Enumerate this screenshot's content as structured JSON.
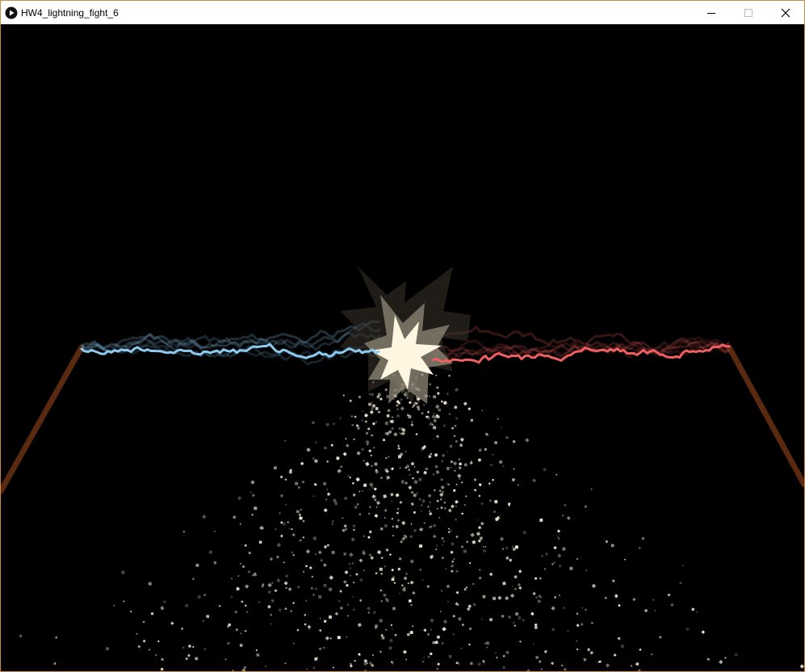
{
  "window": {
    "title": "HW4_lightning_fight_6",
    "controls": {
      "minimize_icon": "minimize-icon",
      "maximize_icon": "maximize-icon",
      "close_icon": "close-icon"
    }
  },
  "scene": {
    "background_color": "#000000",
    "left_bolt_color": "#8ccaf0",
    "right_bolt_color": "#f06060",
    "pole_color": "#5a2a10",
    "impact_color": "#fff6e2",
    "particle_color": "#f3ead6"
  }
}
